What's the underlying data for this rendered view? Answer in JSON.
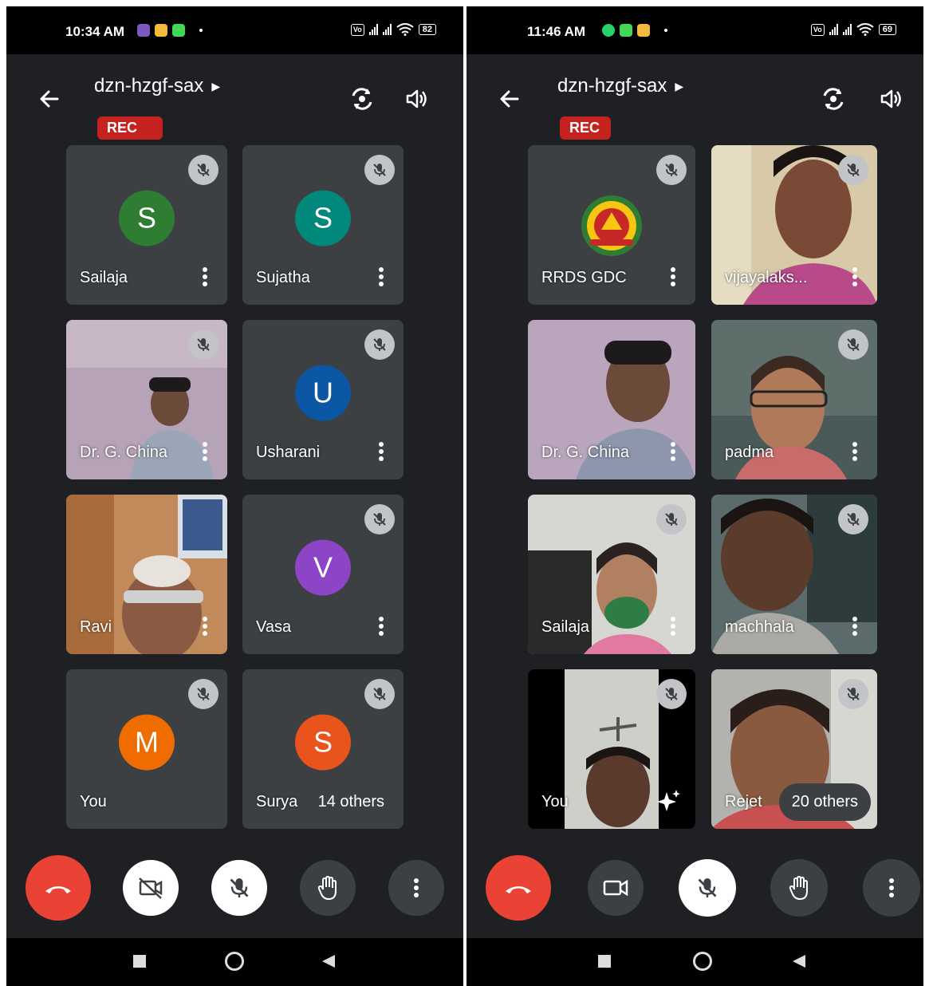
{
  "colors": {
    "background": "#1f2023",
    "tile": "#3c4043",
    "rec": "#c5221f",
    "hangup": "#ea4335"
  },
  "left": {
    "time": "10:34 AM",
    "battery": "82",
    "meeting_code": "dzn-hzgf-sax",
    "rec": "REC",
    "tiles": [
      {
        "name": "Sailaja",
        "initial": "S",
        "color": "#2e7d32"
      },
      {
        "name": "Sujatha",
        "initial": "S",
        "color": "#00897b"
      },
      {
        "name": "Dr. G. China"
      },
      {
        "name": "Usharani",
        "initial": "U",
        "color": "#0b57a3"
      },
      {
        "name": "Ravi"
      },
      {
        "name": "Vasa",
        "initial": "V",
        "color": "#8e44c7"
      },
      {
        "name": "You",
        "initial": "M",
        "color": "#ef6c00"
      },
      {
        "name": "Surya",
        "initial": "S",
        "color": "#e8541c"
      }
    ],
    "others": "14 others"
  },
  "right": {
    "time": "11:46 AM",
    "battery": "69",
    "meeting_code": "dzn-hzgf-sax",
    "rec": "REC",
    "tiles": [
      {
        "name": "RRDS GDC"
      },
      {
        "name": "vijayalaks..."
      },
      {
        "name": "Dr. G. China"
      },
      {
        "name": "padma"
      },
      {
        "name": "Sailaja"
      },
      {
        "name": "machhala"
      },
      {
        "name": "You"
      },
      {
        "name": "Rejet"
      }
    ],
    "others": "20 others"
  }
}
